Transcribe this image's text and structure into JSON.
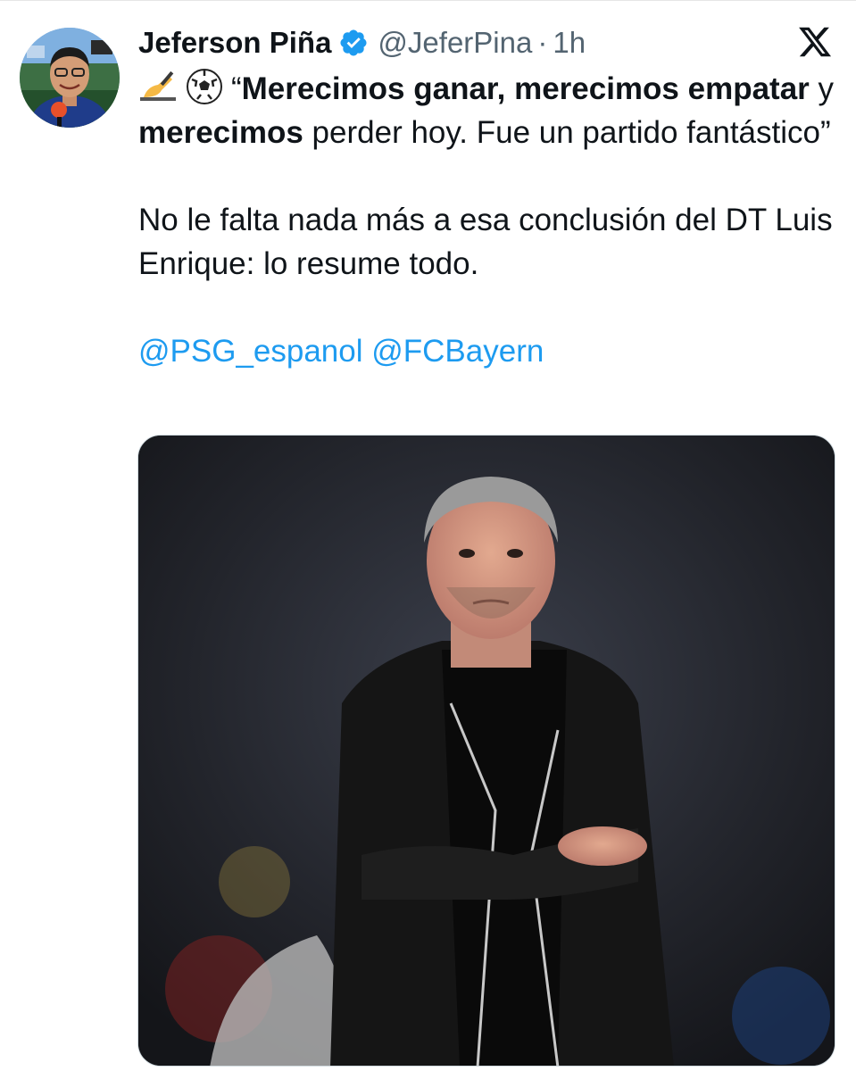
{
  "tweet": {
    "author": {
      "display_name": "Jeferson Piña",
      "handle": "@JeferPina",
      "separator": "·",
      "time": "1h",
      "verified": true
    },
    "icons": {
      "avatar": "avatar-photo",
      "verified": "verified-badge-icon",
      "platform": "x-logo-icon",
      "emoji_1": "writing-hand-emoji",
      "emoji_2": "soccer-ball-emoji"
    },
    "text": {
      "line1_open_quote": "“",
      "bold_1": "Merecimos ganar, merecimos empatar",
      "plain_1": " y ",
      "bold_2": "merecimos",
      "plain_2": " perder hoy. Fue un partido fantástico”",
      "paragraph_2": "No le falta nada más a esa conclusión del DT Luis Enrique: lo resume todo."
    },
    "mentions": [
      "@PSG_espanol",
      "@FCBayern"
    ],
    "media": {
      "kind": "photo",
      "subject": "coach-photo"
    },
    "colors": {
      "link": "#1d9bf0",
      "verified": "#1d9bf0",
      "secondary_text": "#536471"
    }
  }
}
